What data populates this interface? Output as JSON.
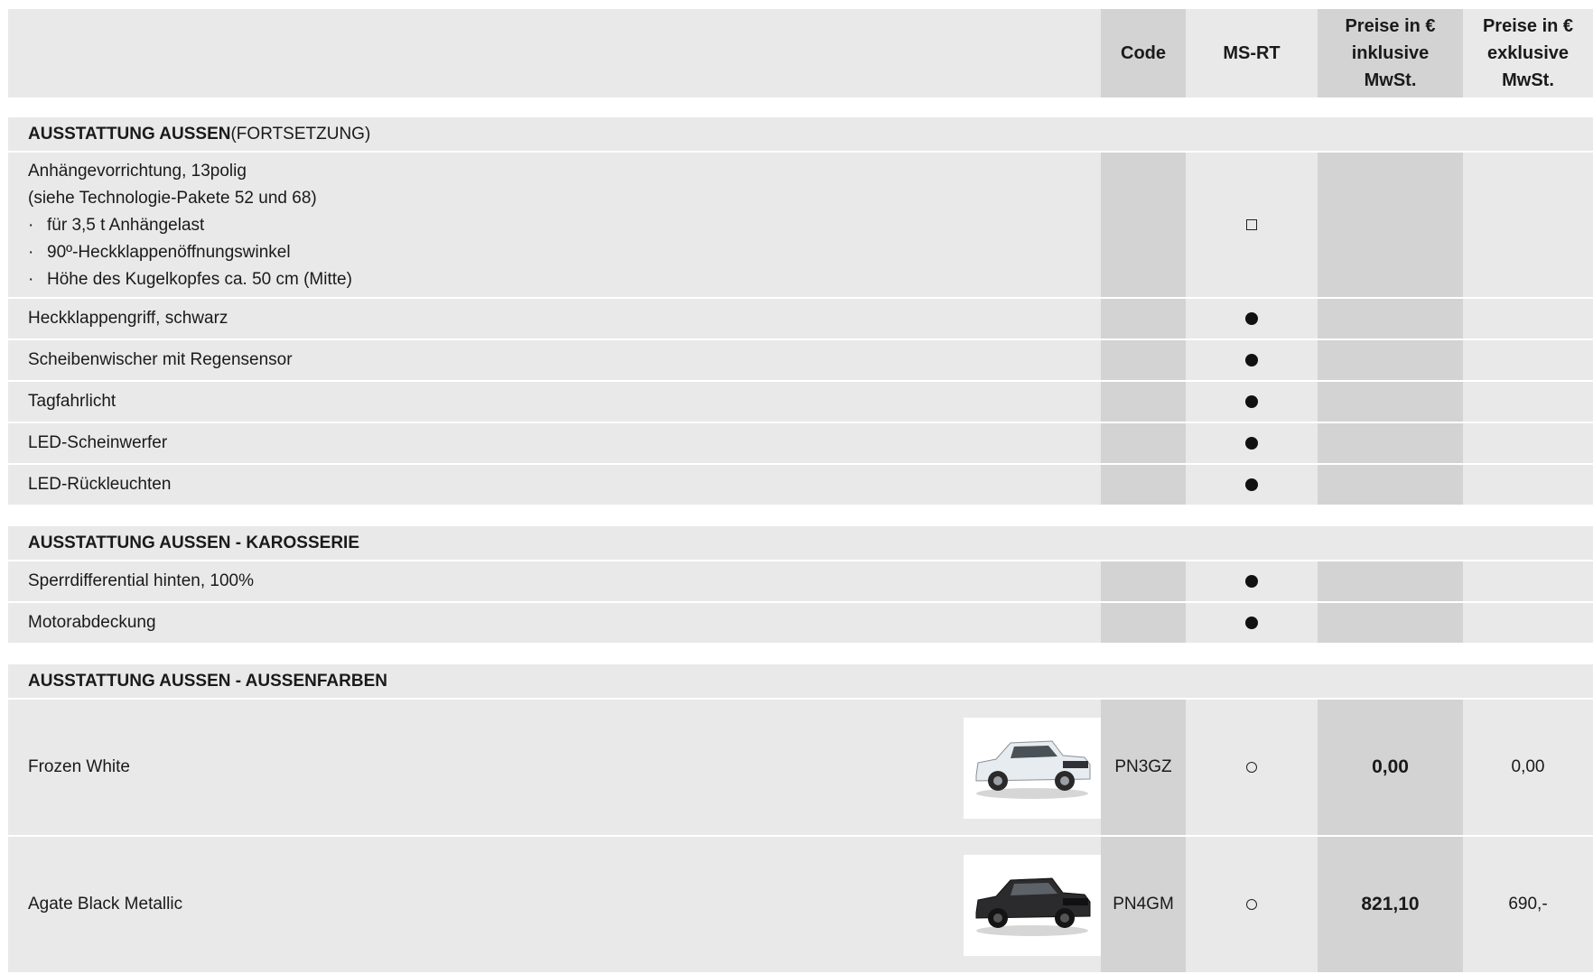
{
  "header": {
    "code": "Code",
    "ms": "MS-RT",
    "inkl": [
      "Preise in €",
      "inklusive",
      "MwSt."
    ],
    "exkl": [
      "Preise in €",
      "exklusive",
      "MwSt."
    ]
  },
  "sections": [
    {
      "title_bold": "AUSSTATTUNG AUSSEN",
      "title_normal": " (FORTSETZUNG)",
      "rows": [
        {
          "lines": [
            "Anhängevorrichtung, 13polig",
            "(siehe Technologie-Pakete 52 und 68)"
          ],
          "bullets": [
            "für 3,5 t Anhängelast",
            "90º-Heckklappenöffnungswinkel",
            "Höhe des Kugelkopfes ca. 50 cm (Mitte)"
          ],
          "ms": "square"
        },
        {
          "label": "Heckklappengriff, schwarz",
          "ms": "dot"
        },
        {
          "label": "Scheibenwischer mit Regensensor",
          "ms": "dot"
        },
        {
          "label": "Tagfahrlicht",
          "ms": "dot"
        },
        {
          "label": "LED-Scheinwerfer",
          "ms": "dot"
        },
        {
          "label": "LED-Rückleuchten",
          "ms": "dot"
        }
      ]
    },
    {
      "title_bold": "AUSSTATTUNG AUSSEN - KAROSSERIE",
      "title_normal": "",
      "rows": [
        {
          "label": "Sperrdifferential hinten, 100%",
          "ms": "dot"
        },
        {
          "label": "Motorabdeckung",
          "ms": "dot"
        }
      ]
    },
    {
      "title_bold": "AUSSTATTUNG AUSSEN - AUSSENFARBEN",
      "title_normal": "",
      "colors": [
        {
          "label": "Frozen White",
          "code": "PN3GZ",
          "ms": "circle",
          "inkl": "0,00",
          "exkl": "0,00",
          "car_color": "#e6ecef"
        },
        {
          "label": "Agate Black Metallic",
          "code": "PN4GM",
          "ms": "circle",
          "inkl": "821,10",
          "exkl": "690,-",
          "car_color": "#2b2b2d"
        }
      ]
    }
  ],
  "legend_icons": {
    "dot": "standard-dot-icon",
    "square": "optional-square-icon",
    "circle": "option-circle-icon"
  }
}
